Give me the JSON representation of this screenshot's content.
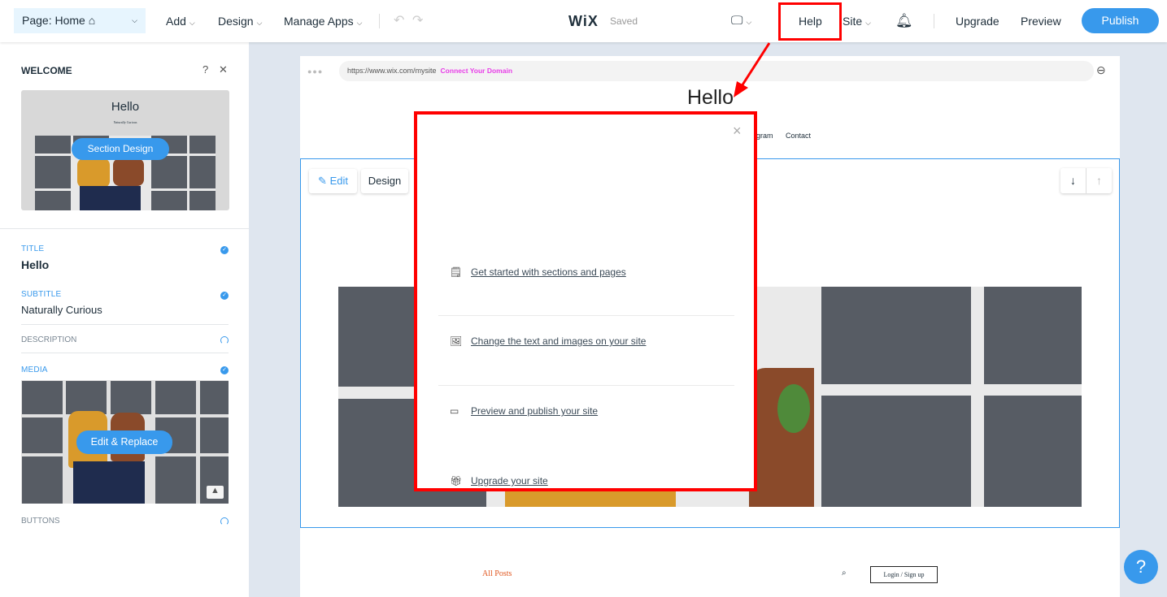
{
  "topbar": {
    "page_selector": "Page: Home ⌂",
    "menus": [
      "Add",
      "Design",
      "Manage Apps"
    ],
    "logo": "WiX",
    "save_status": "Saved",
    "help": "Help",
    "site": "Site",
    "upgrade": "Upgrade",
    "preview": "Preview",
    "publish": "Publish"
  },
  "panel": {
    "title": "WELCOME",
    "help_glyph": "?",
    "close_glyph": "✕",
    "section_design": "Section Design",
    "thumb_title": "Hello",
    "thumb_subtitle": "Naturally Curious",
    "fields": {
      "title_label": "TITLE",
      "title_value": "Hello",
      "subtitle_label": "SUBTITLE",
      "subtitle_value": "Naturally Curious",
      "description_label": "DESCRIPTION",
      "media_label": "MEDIA",
      "buttons_label": "BUTTONS"
    },
    "edit_replace": "Edit & Replace"
  },
  "site": {
    "url": "https://www.wix.com/mysite",
    "connect_domain": "Connect Your Domain",
    "heading": "Hello",
    "nav": [
      "gram",
      "Contact"
    ],
    "edit": "Edit",
    "design": "Design",
    "all_posts": "All Posts",
    "login": "Login / Sign up"
  },
  "popup": {
    "close_glyph": "×",
    "items": [
      {
        "icon": "page-icon",
        "label": "Get started with sections and pages"
      },
      {
        "icon": "images-icon",
        "label": "Change the text and images on your site"
      },
      {
        "icon": "browser-window-icon",
        "label": "Preview and publish your site"
      },
      {
        "icon": "gift-icon",
        "label": "Upgrade your site"
      }
    ]
  },
  "help_bubble": "?",
  "colors": {
    "accent": "#3899ec",
    "highlight": "#ff0000",
    "connect_domain": "#e83ee8",
    "all_posts": "#e0561f"
  }
}
